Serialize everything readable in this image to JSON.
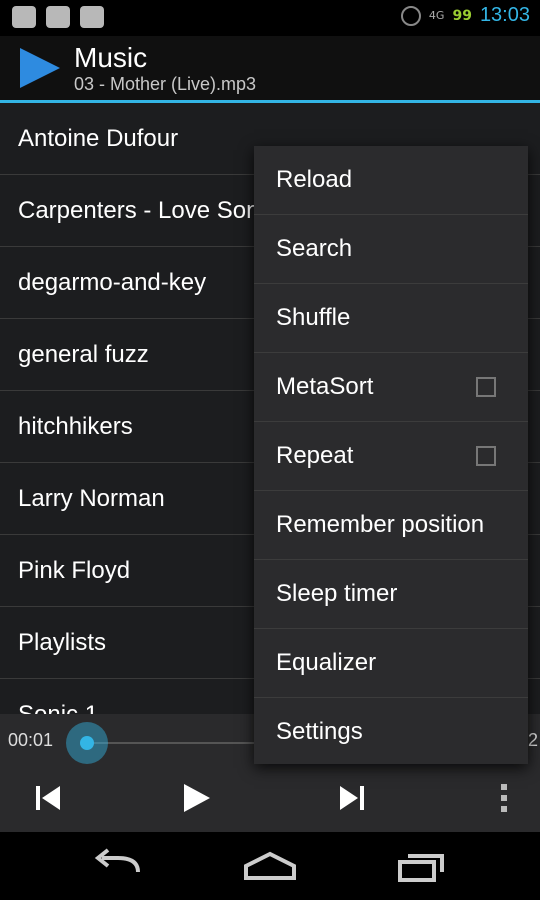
{
  "status_bar": {
    "left_icons": [
      "check-icon",
      "mail-icon",
      "android-icon"
    ],
    "alarm_icon": "alarm-icon",
    "network": "4G",
    "battery": "99",
    "time": "13:03"
  },
  "action_bar": {
    "title": "Music",
    "subtitle": "03 - Mother (Live).mp3"
  },
  "list": {
    "items": [
      "Antoine Dufour",
      "Carpenters - Love Songs",
      "degarmo-and-key",
      "general fuzz",
      "hitchhikers",
      "Larry Norman",
      "Pink Floyd",
      "Playlists",
      "Sonic 1"
    ]
  },
  "player": {
    "elapsed": "00:01",
    "remaining": "2",
    "progress": 0.0
  },
  "menu": {
    "items": [
      {
        "label": "Reload",
        "checkbox": false
      },
      {
        "label": "Search",
        "checkbox": false
      },
      {
        "label": "Shuffle",
        "checkbox": false
      },
      {
        "label": "MetaSort",
        "checkbox": true,
        "checked": false
      },
      {
        "label": "Repeat",
        "checkbox": true,
        "checked": false
      },
      {
        "label": "Remember position",
        "checkbox": false
      },
      {
        "label": "Sleep timer",
        "checkbox": false
      },
      {
        "label": "Equalizer",
        "checkbox": false
      },
      {
        "label": "Settings",
        "checkbox": false
      }
    ]
  },
  "colors": {
    "accent": "#33b5e5",
    "background": "#1c1d1f",
    "menu_bg": "#2b2b2d"
  }
}
